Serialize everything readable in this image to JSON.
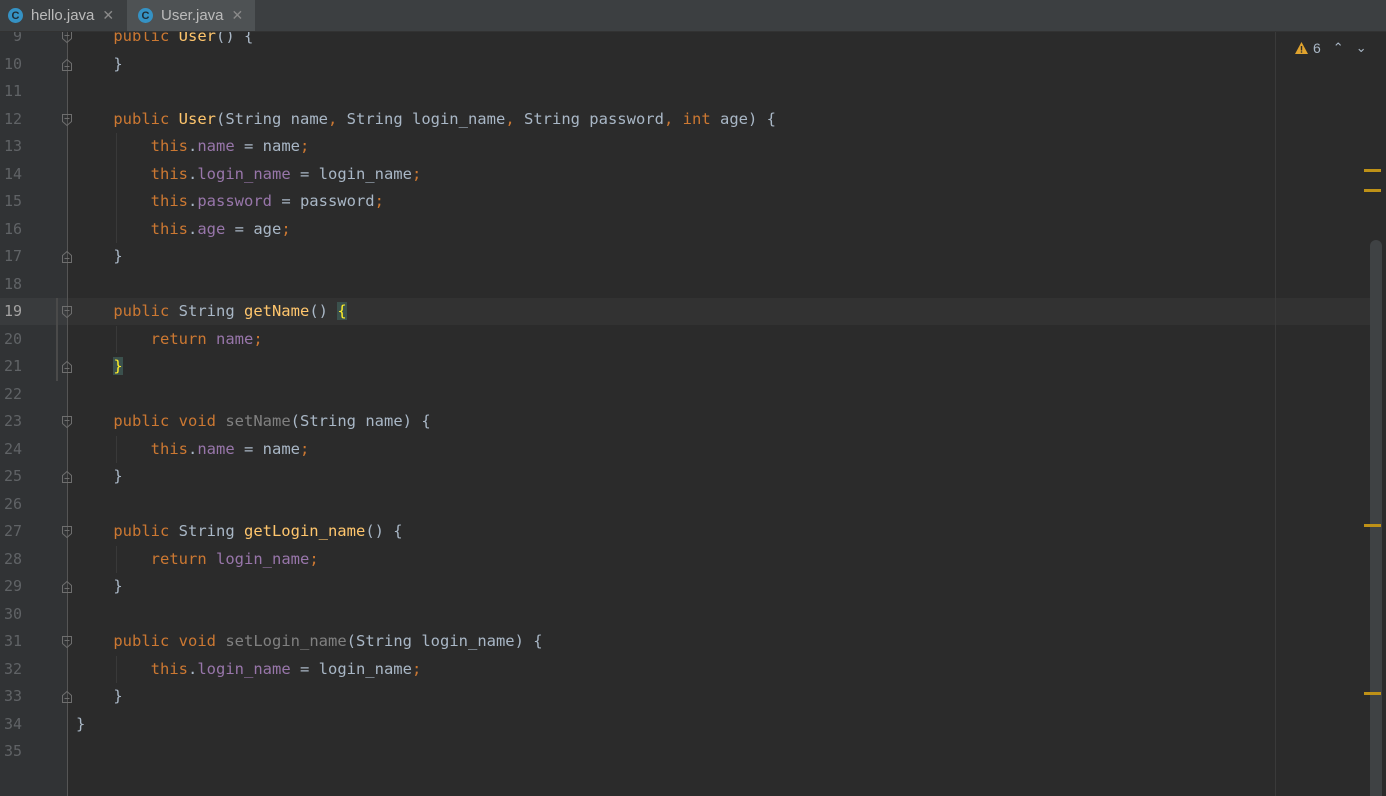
{
  "tabs": [
    {
      "label": "hello.java",
      "icon": "java-class-icon",
      "active": false,
      "close": "✕"
    },
    {
      "label": "User.java",
      "icon": "java-class-icon",
      "active": true,
      "close": "✕"
    }
  ],
  "inspection": {
    "warning_count": "6",
    "icon": "warning-icon",
    "prev": "⌃",
    "next": "⌄",
    "warning_color": "#e0a32e"
  },
  "colors": {
    "keyword": "#cc7832",
    "field": "#9876aa",
    "method": "#ffc66d",
    "text": "#a9b7c6",
    "unused": "#808080",
    "background": "#2b2b2b"
  },
  "current_line": "19",
  "lines": [
    {
      "n": "9",
      "text": "    public User() {"
    },
    {
      "n": "10",
      "text": "    }"
    },
    {
      "n": "11",
      "text": ""
    },
    {
      "n": "12",
      "text": "    public User(String name, String login_name, String password, int age) {"
    },
    {
      "n": "13",
      "text": "        this.name = name;"
    },
    {
      "n": "14",
      "text": "        this.login_name = login_name;"
    },
    {
      "n": "15",
      "text": "        this.password = password;"
    },
    {
      "n": "16",
      "text": "        this.age = age;"
    },
    {
      "n": "17",
      "text": "    }"
    },
    {
      "n": "18",
      "text": ""
    },
    {
      "n": "19",
      "text": "    public String getName() {"
    },
    {
      "n": "20",
      "text": "        return name;"
    },
    {
      "n": "21",
      "text": "    }"
    },
    {
      "n": "22",
      "text": ""
    },
    {
      "n": "23",
      "text": "    public void setName(String name) {"
    },
    {
      "n": "24",
      "text": "        this.name = name;"
    },
    {
      "n": "25",
      "text": "    }"
    },
    {
      "n": "26",
      "text": ""
    },
    {
      "n": "27",
      "text": "    public String getLogin_name() {"
    },
    {
      "n": "28",
      "text": "        return login_name;"
    },
    {
      "n": "29",
      "text": "    }"
    },
    {
      "n": "30",
      "text": ""
    },
    {
      "n": "31",
      "text": "    public void setLogin_name(String login_name) {"
    },
    {
      "n": "32",
      "text": "        this.login_name = login_name;"
    },
    {
      "n": "33",
      "text": "    }"
    },
    {
      "n": "34",
      "text": "}"
    },
    {
      "n": "35",
      "text": ""
    }
  ]
}
